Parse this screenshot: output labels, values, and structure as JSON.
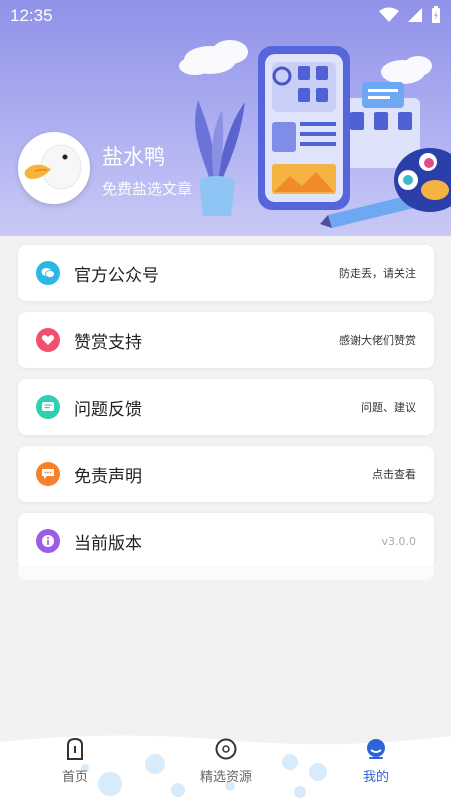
{
  "status_bar": {
    "time": "12:35"
  },
  "profile": {
    "name": "盐水鸭",
    "subtitle": "免费盐选文章"
  },
  "menu": [
    {
      "title": "官方公众号",
      "note": "防走丢，请关注",
      "icon": "wechat-icon",
      "color": "#2db7e6"
    },
    {
      "title": "赞赏支持",
      "note": "感谢大佬们赞赏",
      "icon": "heart-icon",
      "color": "#f0506e"
    },
    {
      "title": "问题反馈",
      "note": "问题、建议",
      "icon": "feedback-icon",
      "color": "#2fcfb0"
    },
    {
      "title": "免责声明",
      "note": "点击查看",
      "icon": "message-icon",
      "color": "#f5822a"
    },
    {
      "title": "当前版本",
      "note": "v3.0.0",
      "icon": "info-icon",
      "color": "#9b5ce6"
    }
  ],
  "nav": {
    "home": "首页",
    "resources": "精选资源",
    "mine": "我的",
    "active_color": "#2f63d8"
  }
}
